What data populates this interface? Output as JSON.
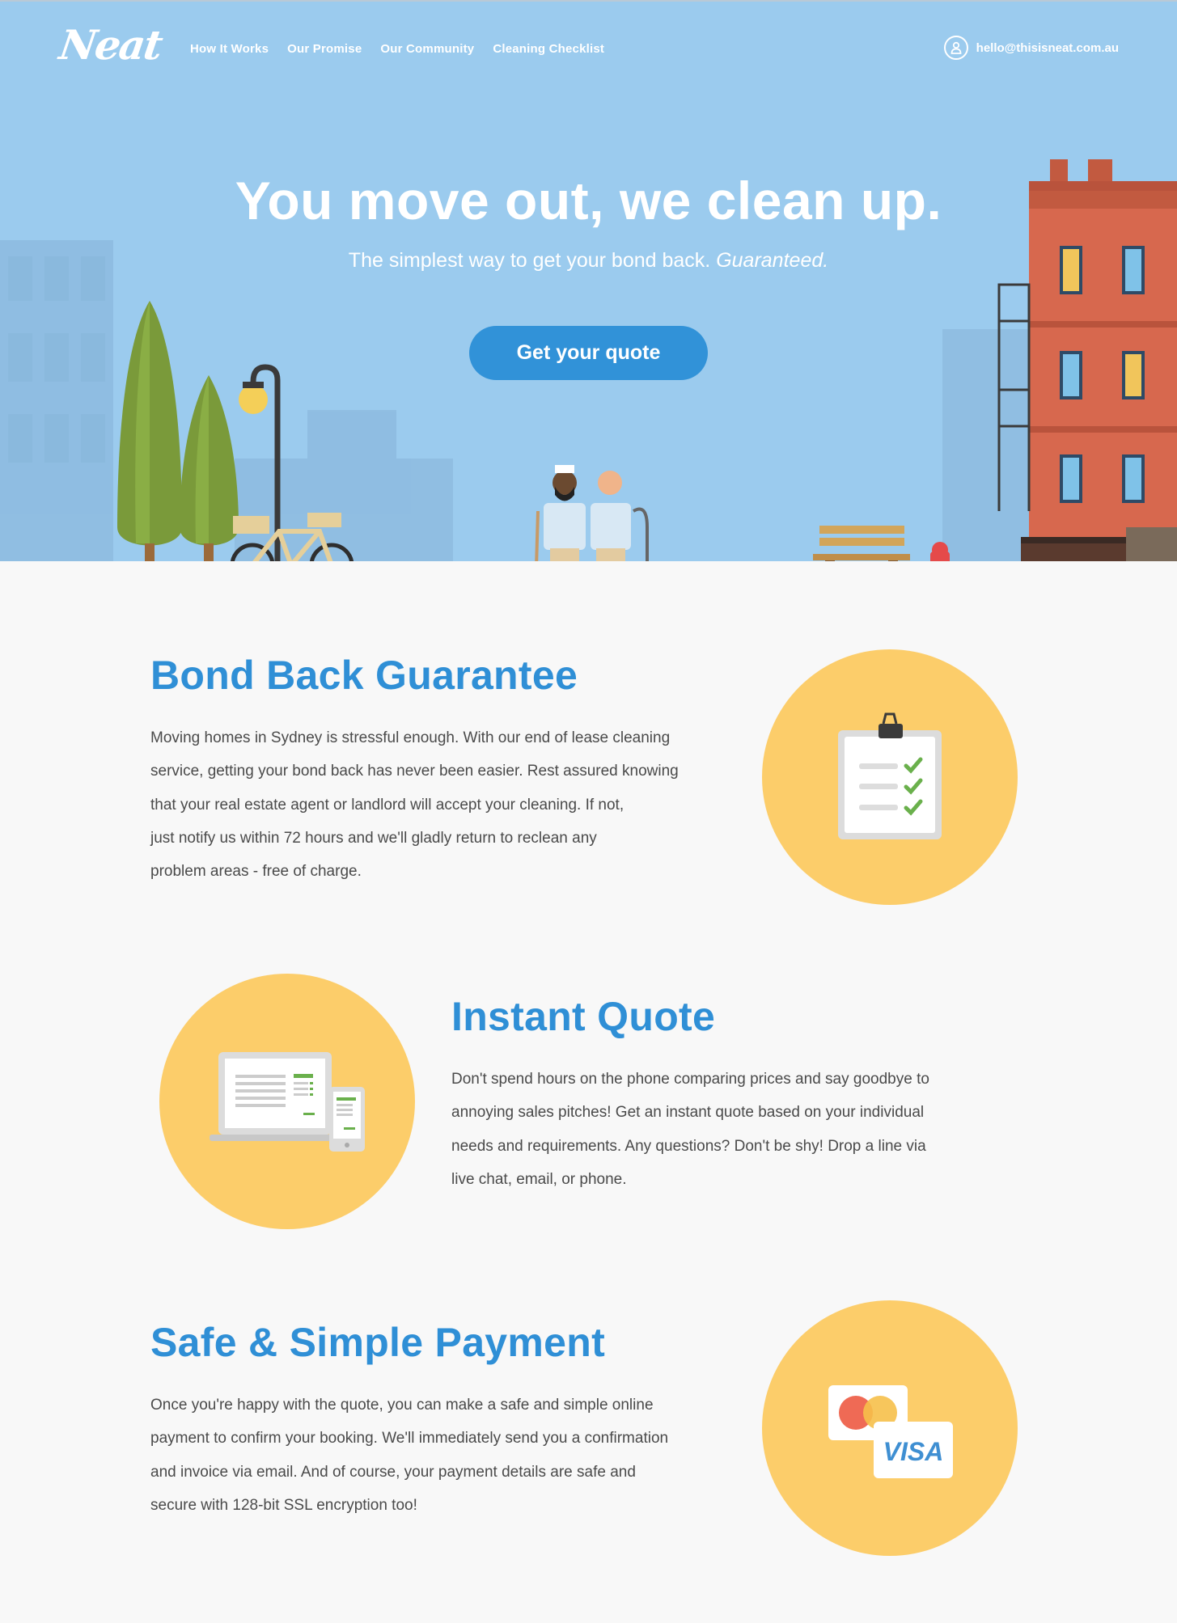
{
  "header": {
    "logo": "Neat",
    "nav": [
      "How It Works",
      "Our Promise",
      "Our Community",
      "Cleaning Checklist"
    ],
    "email": "hello@thisisneat.com.au"
  },
  "hero": {
    "title": "You move out, we clean up.",
    "subtitle": "The simplest way to get your bond back.",
    "subtitle_emphasis": "Guaranteed.",
    "cta": "Get your quote"
  },
  "sections": [
    {
      "title": "Bond Back Guarantee",
      "lines": [
        "Moving homes in Sydney is stressful enough. With our end of lease cleaning",
        "service, getting your bond back has never been easier. Rest assured knowing",
        "that your real estate agent or landlord will accept your cleaning. If not,",
        "just notify us within 72 hours and we'll gladly return to reclean any",
        "problem areas - free of charge."
      ],
      "icon": "clipboard-checklist-icon"
    },
    {
      "title": "Instant Quote",
      "lines": [
        "Don't spend hours on the phone comparing prices and say goodbye to",
        "annoying sales pitches! Get an instant quote based on your individual",
        "needs and requirements. Any questions? Don't be shy! Drop a line via",
        "live chat, email, or phone."
      ],
      "icon": "laptop-tablet-icon"
    },
    {
      "title": "Safe & Simple Payment",
      "lines": [
        "Once you're happy with the quote, you can make a safe and simple online",
        "payment to confirm your booking. We'll immediately send you a confirmation",
        "and invoice via email. And of course, your payment details are safe and",
        "secure with 128-bit SSL encryption too!"
      ],
      "icon": "credit-cards-icon",
      "card_brand": "VISA"
    }
  ],
  "colors": {
    "sky": "#9bcbee",
    "accent": "#2f8fd6",
    "button": "#3192d8",
    "circle": "#fccd6a",
    "background": "#f8f8f8"
  }
}
